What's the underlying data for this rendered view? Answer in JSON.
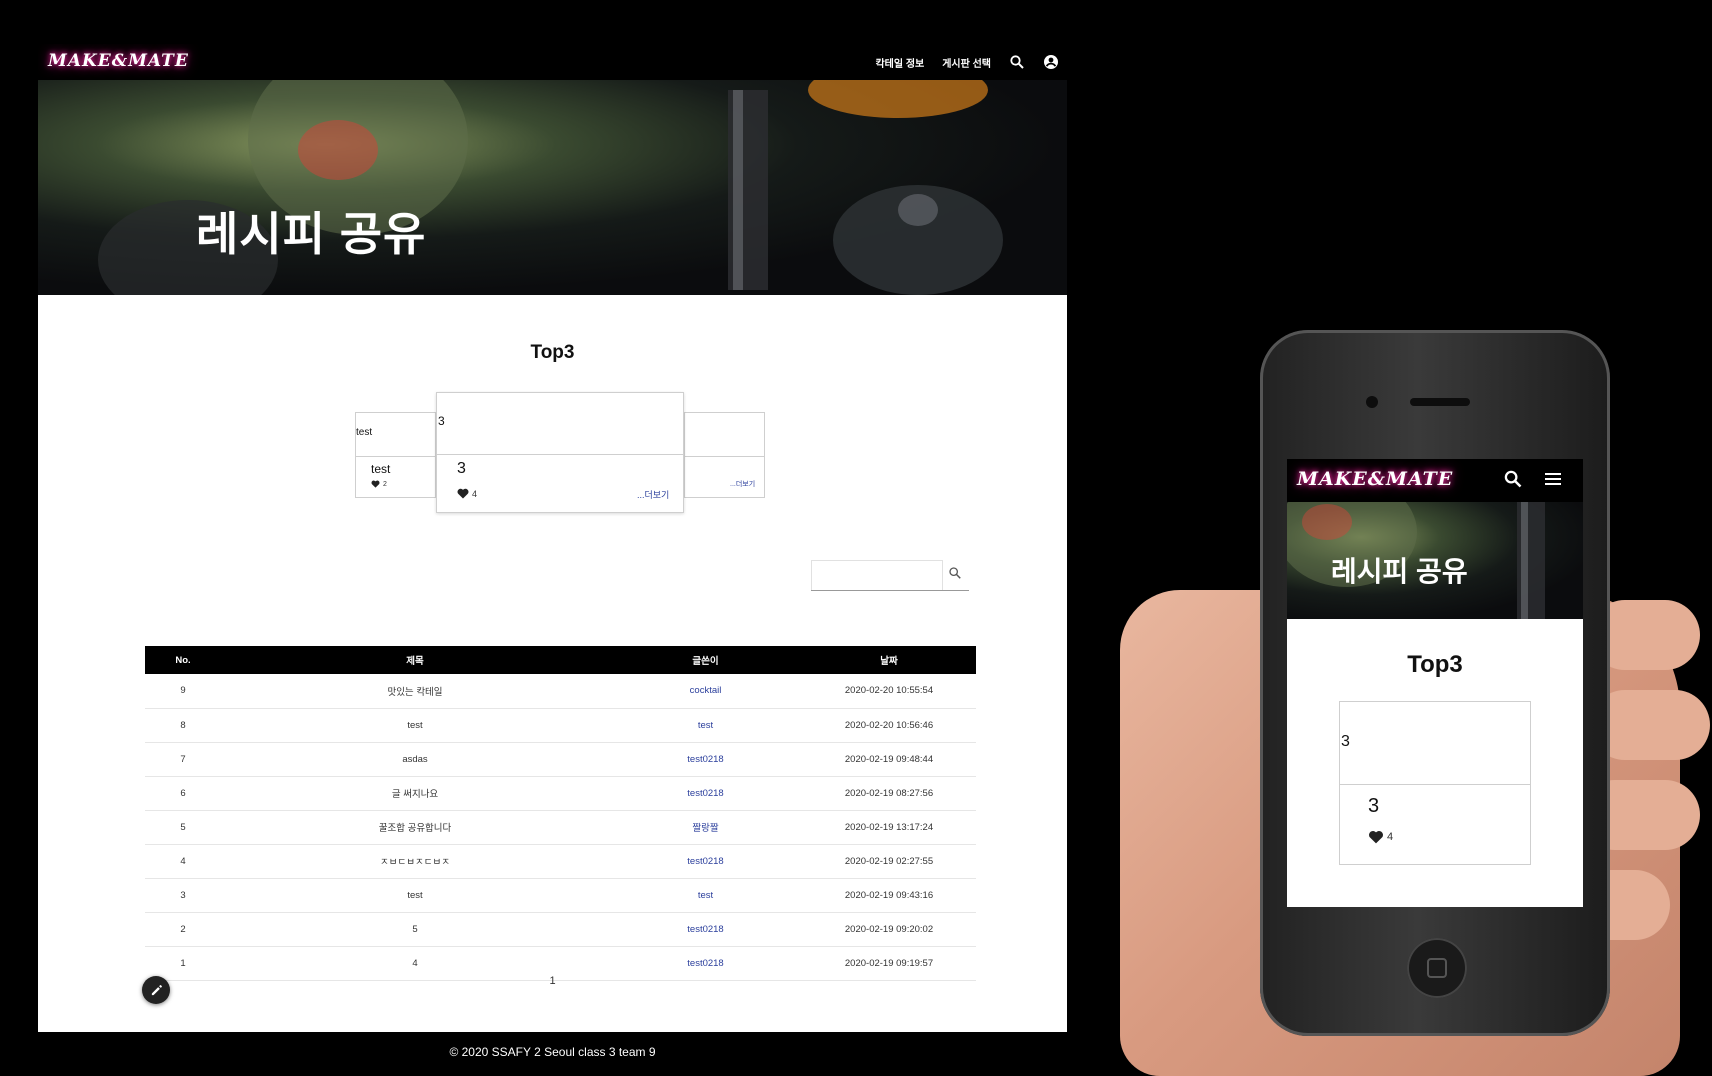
{
  "brand": "MAKE&MATE",
  "nav": {
    "cocktail_info": "칵테일 정보",
    "board_select": "게시판 선택"
  },
  "hero": {
    "title": "레시피 공유"
  },
  "top3": {
    "title": "Top3",
    "cards": [
      {
        "image_alt": "test",
        "title": "test",
        "likes": "2",
        "more": ""
      },
      {
        "image_alt": "3",
        "title": "3",
        "likes": "4",
        "more": "...더보기"
      },
      {
        "image_alt": "",
        "title": "",
        "likes": "",
        "more": "...더보기"
      }
    ]
  },
  "search": {
    "value": "",
    "placeholder": ""
  },
  "table": {
    "headers": {
      "no": "No.",
      "title": "제목",
      "author": "글쓴이",
      "date": "날짜"
    },
    "rows": [
      {
        "no": "9",
        "title": "맛있는 칵테일",
        "author": "cocktail",
        "date": "2020-02-20 10:55:54"
      },
      {
        "no": "8",
        "title": "test",
        "author": "test",
        "date": "2020-02-20 10:56:46"
      },
      {
        "no": "7",
        "title": "asdas",
        "author": "test0218",
        "date": "2020-02-19 09:48:44"
      },
      {
        "no": "6",
        "title": "글 써지나요",
        "author": "test0218",
        "date": "2020-02-19 08:27:56"
      },
      {
        "no": "5",
        "title": "꿀조합 공유합니다",
        "author": "짤랑짤",
        "date": "2020-02-19 13:17:24"
      },
      {
        "no": "4",
        "title": "ㅈㅂㄷㅂㅈㄷㅂㅈ",
        "author": "test0218",
        "date": "2020-02-19 02:27:55"
      },
      {
        "no": "3",
        "title": "test",
        "author": "test",
        "date": "2020-02-19 09:43:16"
      },
      {
        "no": "2",
        "title": "5",
        "author": "test0218",
        "date": "2020-02-19 09:20:02"
      },
      {
        "no": "1",
        "title": "4",
        "author": "test0218",
        "date": "2020-02-19 09:19:57"
      }
    ]
  },
  "pagination": {
    "current": "1"
  },
  "footer": {
    "text": "© 2020 SSAFY 2 Seoul class 3 team 9"
  },
  "mobile": {
    "brand": "MAKE&MATE",
    "hero_title": "레시피 공유",
    "top3_title": "Top3",
    "card": {
      "image_alt": "3",
      "title": "3",
      "likes": "4"
    }
  },
  "colors": {
    "accent_glow": "#ff2fa8",
    "link": "#2b3f9c",
    "header_bg": "#000000"
  },
  "icons": [
    "search-icon",
    "account-circle-icon",
    "heart-icon",
    "pencil-icon",
    "menu-icon"
  ]
}
